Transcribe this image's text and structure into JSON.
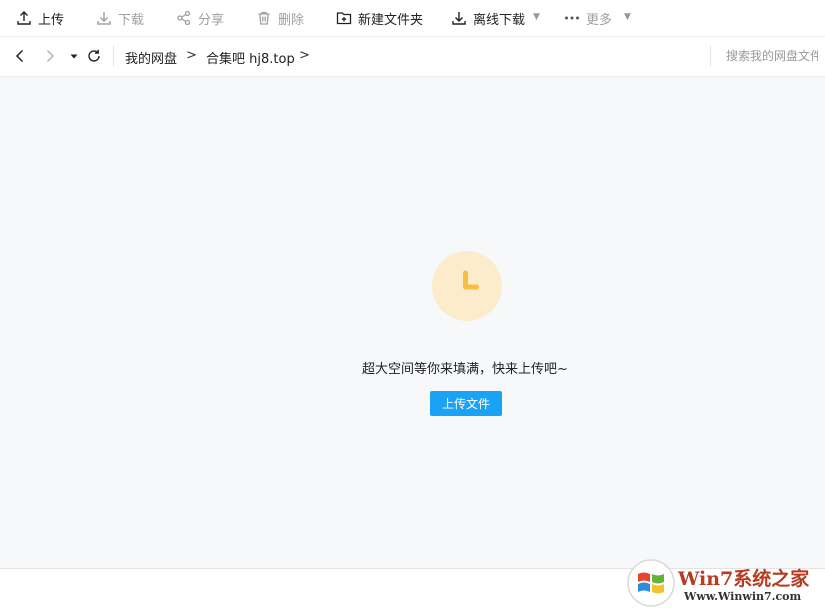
{
  "toolbar": {
    "upload": "上传",
    "download": "下载",
    "share": "分享",
    "delete": "删除",
    "new_folder": "新建文件夹",
    "offline_download": "离线下载",
    "more": "更多"
  },
  "breadcrumb": {
    "root": "我的网盘",
    "folder": "合集吧 hj8.top",
    "separator": ">"
  },
  "search": {
    "placeholder": "搜索我的网盘文件"
  },
  "empty_state": {
    "message": "超大空间等你来填满，快来上传吧~",
    "upload_button": "上传文件"
  },
  "watermark": {
    "title": "Win7系统之家",
    "url": "Www.Winwin7.com"
  },
  "colors": {
    "accent": "#1aa3f5",
    "empty_icon_bg": "#fdeccb",
    "empty_icon_fg": "#f5bf42"
  }
}
